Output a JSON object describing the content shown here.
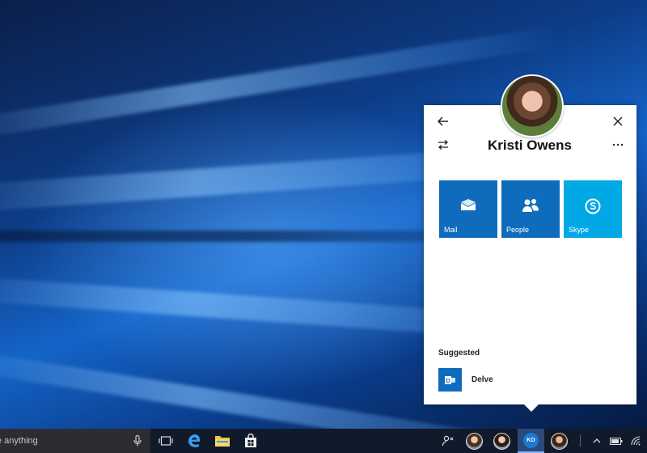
{
  "flyout": {
    "contact_name": "Kristi Owens",
    "quick_actions": [
      {
        "label": "Mail",
        "icon": "mail-icon",
        "color": "#0f6cbd"
      },
      {
        "label": "People",
        "icon": "people-icon",
        "color": "#0f6cbd"
      },
      {
        "label": "Skype",
        "icon": "skype-icon",
        "color": "#00a8e6"
      }
    ],
    "suggested_heading": "Suggested",
    "suggested_apps": [
      {
        "label": "Delve",
        "icon": "delve-icon",
        "color": "#0f6cbd"
      }
    ]
  },
  "taskbar": {
    "search_text": "e anything",
    "pinned_contact_initials": "KO"
  },
  "colors": {
    "accent": "#0f6cbd",
    "skype": "#00a8e6",
    "taskbar": "#101a2a"
  }
}
